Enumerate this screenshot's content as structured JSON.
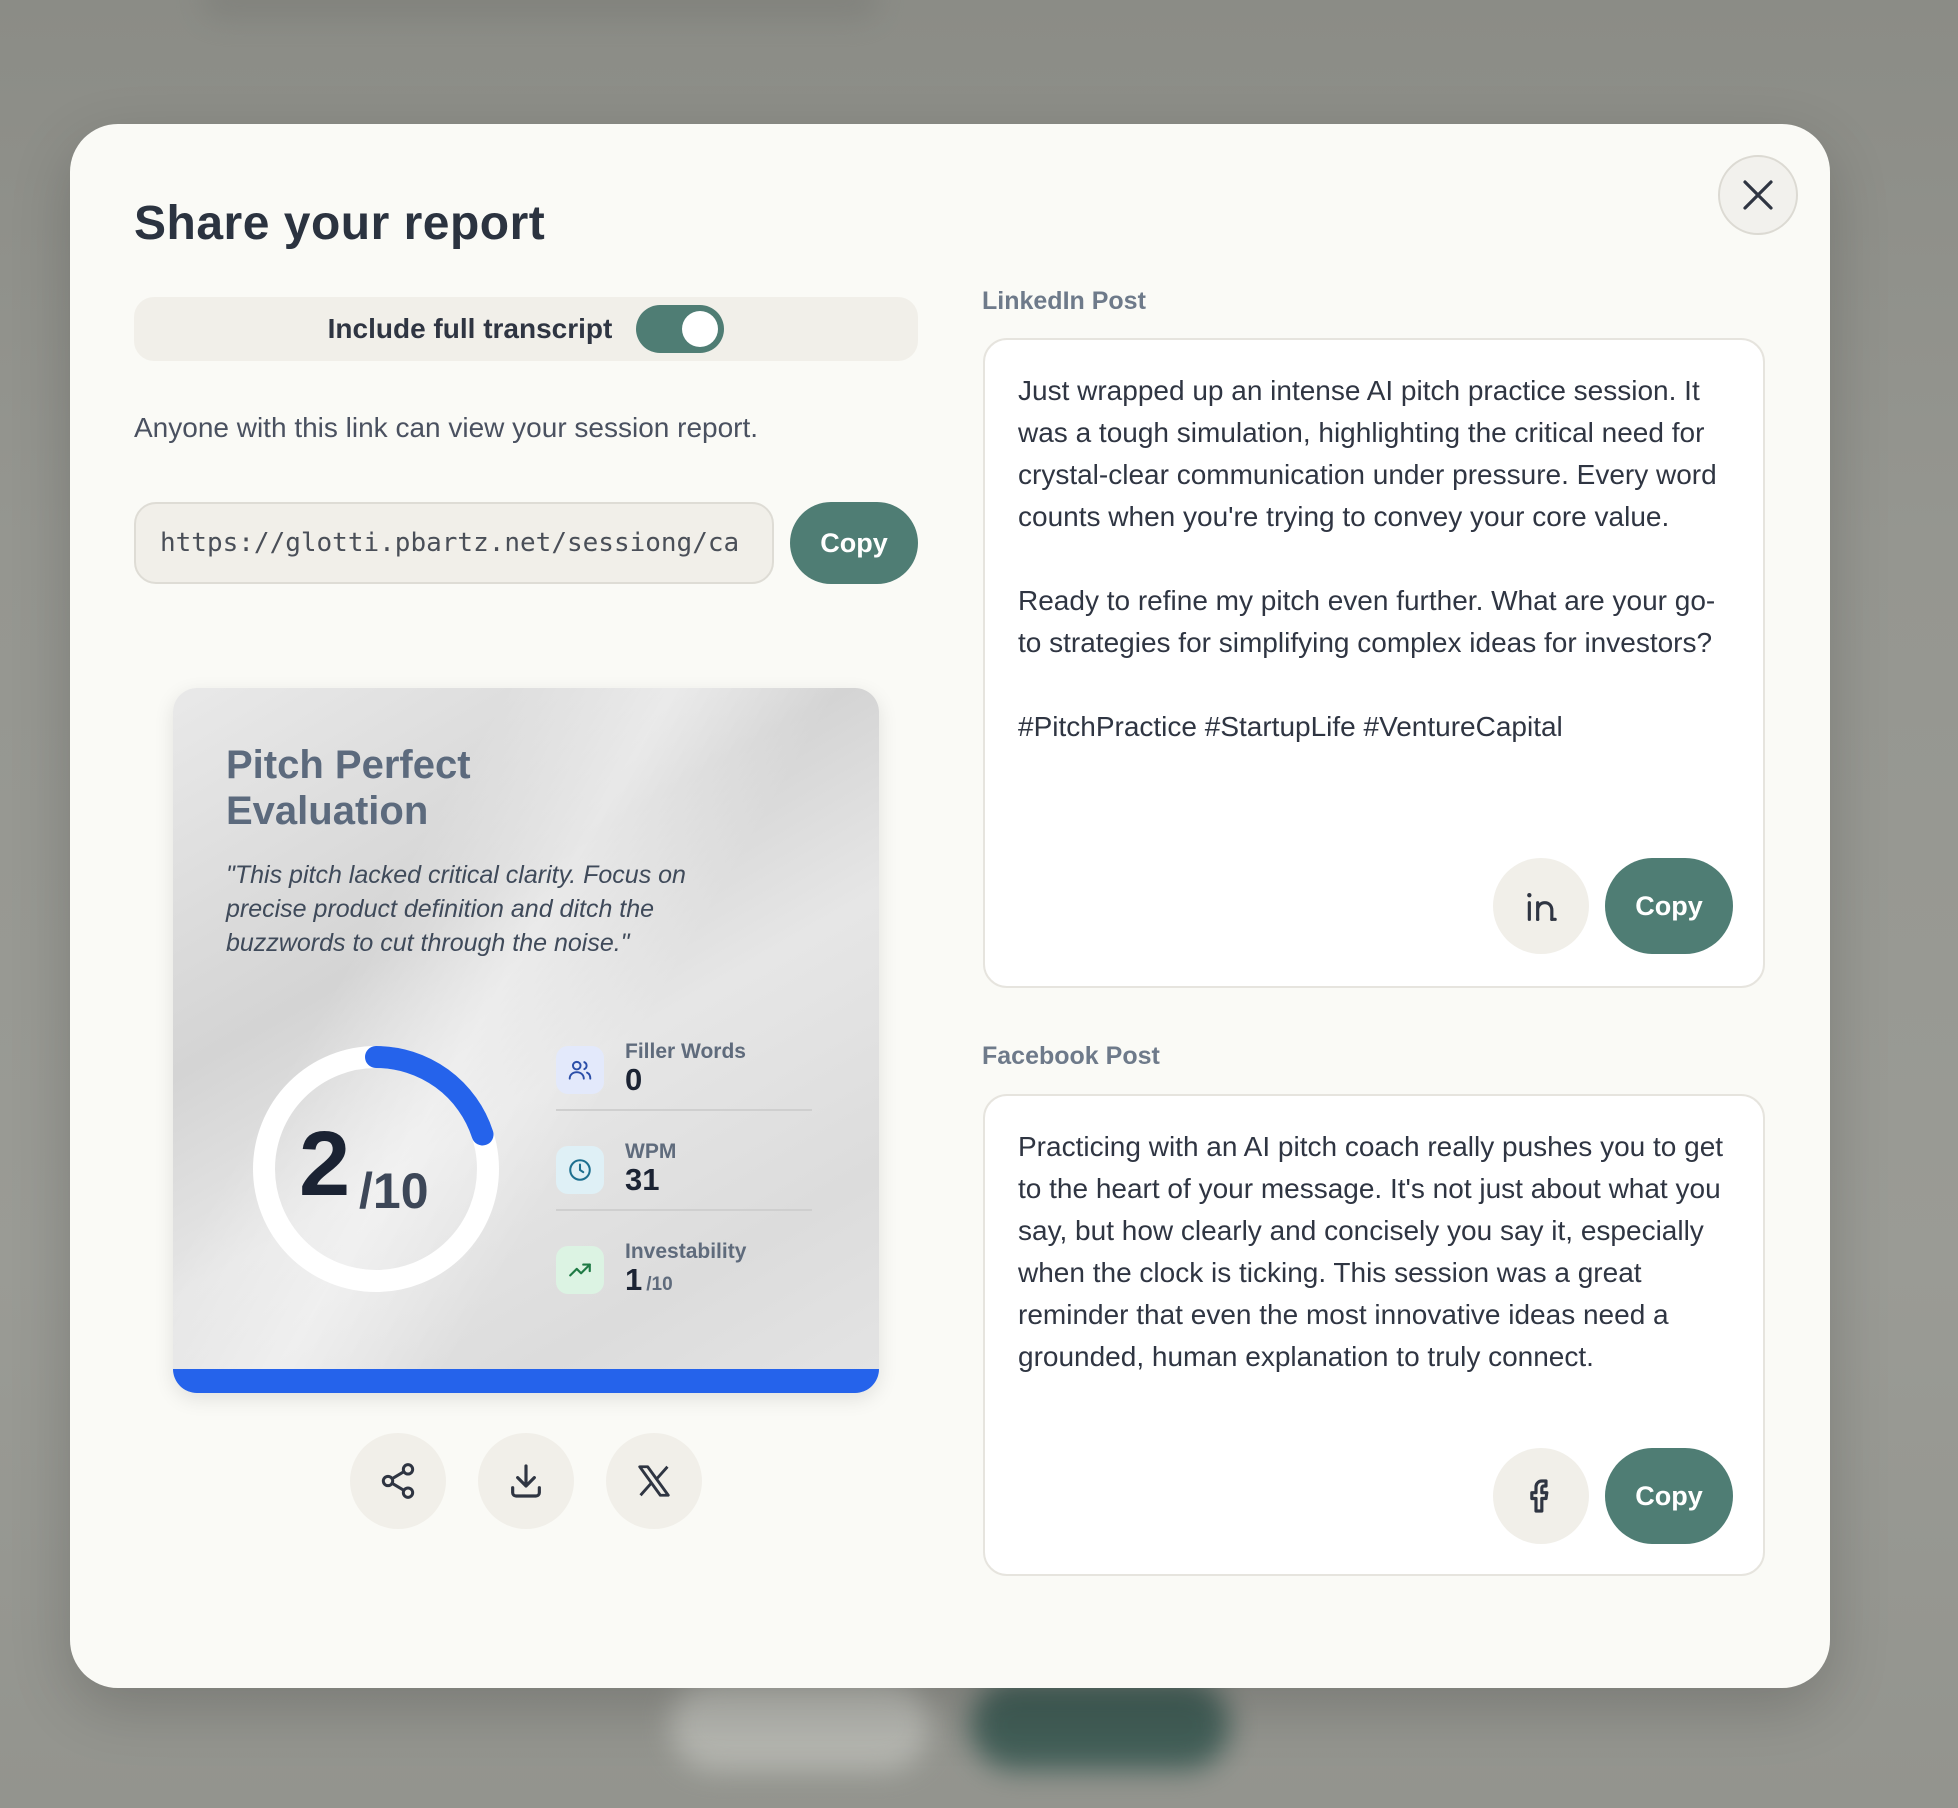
{
  "modal": {
    "title": "Share your report",
    "toggle": {
      "label": "Include full transcript",
      "on": true
    },
    "link_note": "Anyone with this link can view your session report.",
    "url_value": "https://glotti.pbartz.net/sessiong/ca",
    "url_copy_label": "Copy"
  },
  "card": {
    "title": "Pitch Perfect Evaluation",
    "quote": "\"This pitch lacked critical clarity. Focus on precise product definition and ditch the buzzwords to cut through the noise.\"",
    "score": "2",
    "score_denominator": "/10",
    "score_fraction": 0.2,
    "metrics": [
      {
        "label": "Filler Words",
        "value": "0",
        "suffix": "",
        "icon": "users-icon"
      },
      {
        "label": "WPM",
        "value": "31",
        "suffix": "",
        "icon": "clock-icon"
      },
      {
        "label": "Investability",
        "value": "1",
        "suffix": "/10",
        "icon": "trending-up-icon"
      }
    ],
    "accent_color": "#2563eb"
  },
  "card_actions": [
    "share-icon",
    "download-icon",
    "x-logo-icon"
  ],
  "linkedin": {
    "label": "LinkedIn Post",
    "text": "Just wrapped up an intense AI pitch practice session. It was a tough simulation, highlighting the critical need for crystal-clear communication under pressure. Every word counts when you're trying to convey your core value.\n\nReady to refine my pitch even further. What are your go-to strategies for simplifying complex ideas for investors?\n\n#PitchPractice #StartupLife #VentureCapital",
    "copy_label": "Copy",
    "icon": "linkedin-icon"
  },
  "facebook": {
    "label": "Facebook Post",
    "text": "Practicing with an AI pitch coach really pushes you to get to the heart of your message. It's not just about what you say, but how clearly and concisely you say it, especially when the clock is ticking. This session was a great reminder that even the most innovative ideas need a grounded, human explanation to truly connect.",
    "copy_label": "Copy",
    "icon": "facebook-icon"
  },
  "colors": {
    "primary_button": "#4f7d74",
    "modal_bg": "#fafaf6",
    "overlay": "#8f908a"
  }
}
